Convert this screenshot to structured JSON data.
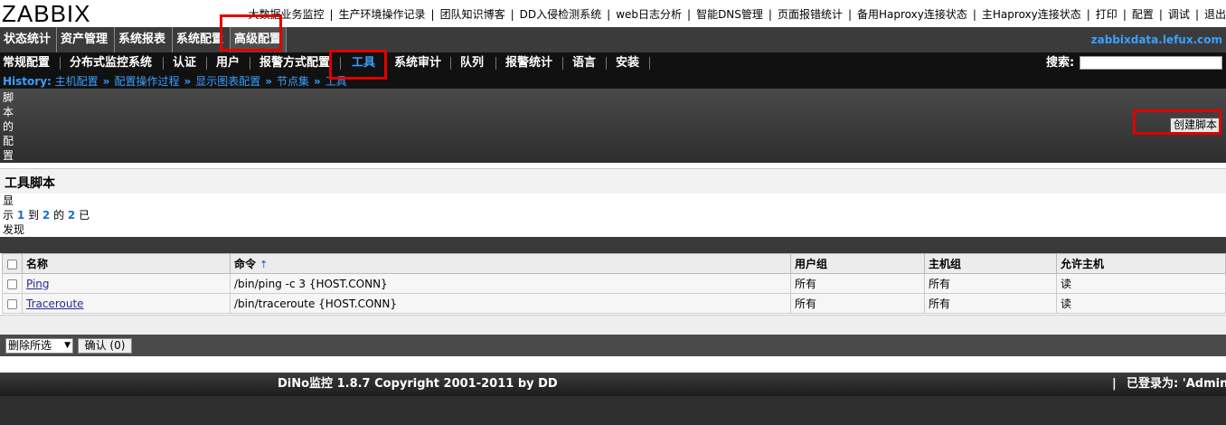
{
  "logo": "ZABBIX",
  "top_links": [
    "大数据业务监控",
    "生产环境操作记录",
    "团队知识博客",
    "DD入侵检测系统",
    "web日志分析",
    "智能DNS管理",
    "页面报错统计",
    "备用Haproxy连接状态",
    "主Haproxy连接状态"
  ],
  "utility_links": [
    "打印",
    "配置",
    "调试",
    "退出"
  ],
  "main_menu": [
    "状态统计",
    "资产管理",
    "系统报表",
    "系统配置",
    "高级配置"
  ],
  "host_link": "zabbixdata.lefux.com",
  "sub_menu": [
    "常规配置",
    "分布式监控系统",
    "认证",
    "用户",
    "报警方式配置",
    "工具",
    "系统审计",
    "队列",
    "报警统计",
    "语言",
    "安装"
  ],
  "search_label": "搜索:",
  "history": {
    "label": "History:",
    "items": [
      "主机配置",
      "配置操作过程",
      "显示图表配置",
      "节点集",
      "工具"
    ]
  },
  "page_heading_chars": [
    "脚",
    "本",
    "的",
    "配",
    "置"
  ],
  "create_button": "创建脚本",
  "section_title": "工具脚本",
  "info": {
    "w1": "显",
    "w2": "示",
    "from": "1",
    "w3": "到",
    "to": "2",
    "w4": "的",
    "total": "2",
    "w5": "已",
    "w6": "发现"
  },
  "table": {
    "headers": [
      "名称",
      "命令",
      "用户组",
      "主机组",
      "允许主机"
    ],
    "rows": [
      {
        "name": "Ping",
        "command": "/bin/ping -c 3 {HOST.CONN}",
        "user_group": "所有",
        "host_group": "所有",
        "access": "读"
      },
      {
        "name": "Traceroute",
        "command": "/bin/traceroute {HOST.CONN}",
        "user_group": "所有",
        "host_group": "所有",
        "access": "读"
      }
    ]
  },
  "action_select": "删除所选",
  "confirm_button": "确认 (0)",
  "footer": {
    "copyright": "DiNo监控 1.8.7 Copyright 2001-2011 by DD",
    "separator": "|",
    "logged_in": "已登录为: 'Admin'"
  },
  "colors": {
    "accent": "#3aa0ff",
    "highlight_box": "#e00000",
    "menu_bg": "#3b3b3b"
  }
}
